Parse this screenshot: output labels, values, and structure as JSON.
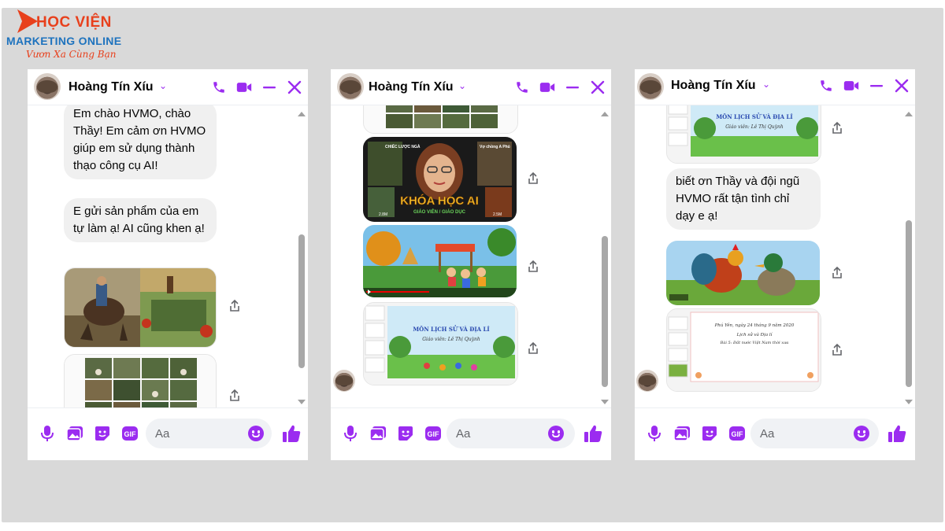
{
  "brand": {
    "name_line1": "HỌC VIỆN",
    "name_line2": "MARKETING ONLINE",
    "slogan": "Vươn Xa Cùng Bạn"
  },
  "colors": {
    "accent": "#9b2cf0",
    "bubble": "#f0f0f0",
    "brand_orange": "#e8401c",
    "brand_blue": "#1e73be"
  },
  "chats": [
    {
      "contact_name": "Hoàng Tín Xíu",
      "header_icons": [
        "phone-icon",
        "video-icon",
        "minimize-icon",
        "close-icon"
      ],
      "messages": [
        "Em chào HVMO, chào Thầy! Em cảm ơn HVMO giúp em sử dụng thành thạo công cụ AI!",
        "E gửi sản phẩm của em tự làm ạ! AI cũng khen ạ!"
      ],
      "input_placeholder": "Aa"
    },
    {
      "contact_name": "Hoàng Tín Xíu",
      "header_icons": [
        "phone-icon",
        "video-icon",
        "minimize-icon",
        "close-icon"
      ],
      "image_texts": {
        "poster_title": "KHÓA HỌC AI",
        "poster_sub": "GIÁO VIÊN / GIÁO DỤC",
        "poster_tl": "CHIẾC LƯỢC NGÀ",
        "poster_tr": "Vợ chồng A Phủ",
        "views_left": "2.8M",
        "views_right": "2.5M",
        "slide_title": "MÔN LỊCH SỬ VÀ ĐỊA LÍ",
        "slide_sub": "Giáo viên: Lê Thị Quỳnh"
      },
      "input_placeholder": "Aa"
    },
    {
      "contact_name": "Hoàng Tín Xíu",
      "header_icons": [
        "phone-icon",
        "video-icon",
        "minimize-icon",
        "close-icon"
      ],
      "messages": [
        "biết ơn Thầy và đội ngũ HVMO rất tận tình chỉ dạy e ạ!"
      ],
      "image_texts": {
        "slide_title": "MÔN LỊCH SỬ VÀ ĐỊA LÍ",
        "slide_sub": "Giáo viên: Lê Thị Quỳnh",
        "letter_line1": "Phú Yên, ngày 24 tháng 9 năm 2020",
        "letter_line2": "Lịch sử và Địa lí",
        "letter_line3": "Bài 5: Đất nước Việt Nam thời xưa"
      },
      "input_placeholder": "Aa"
    }
  ]
}
